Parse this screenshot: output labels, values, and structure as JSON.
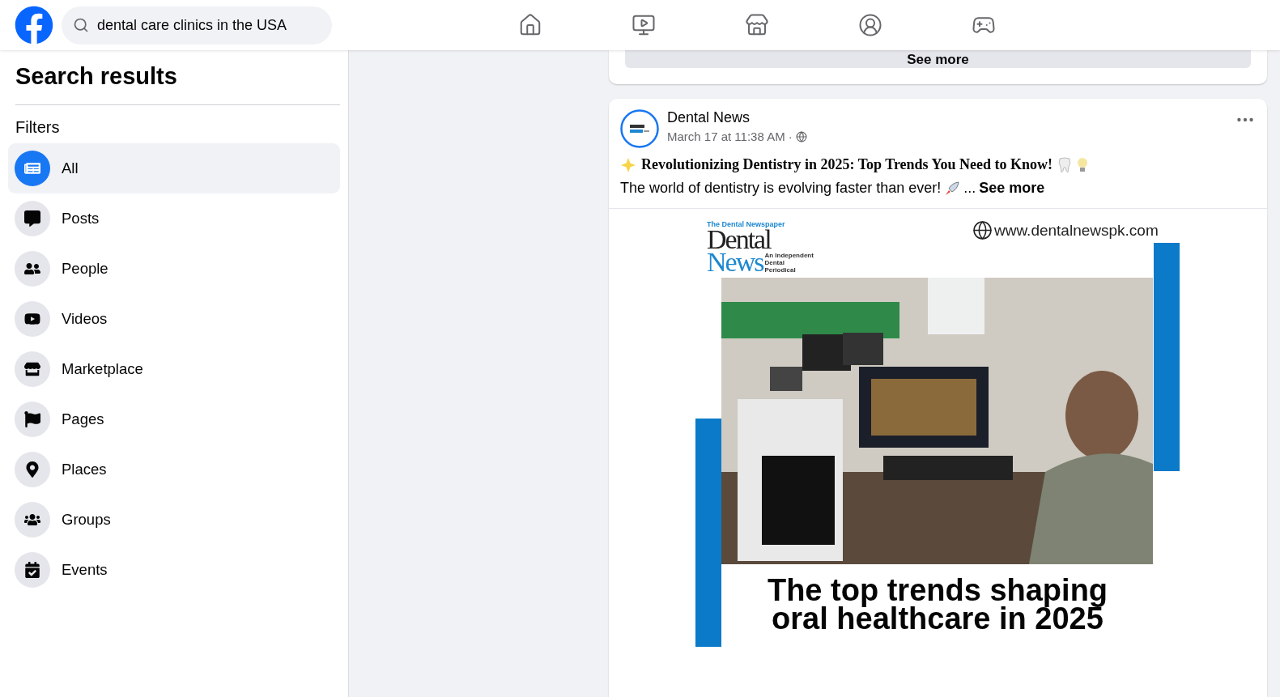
{
  "header": {
    "search": {
      "value": "dental care clinics in the USA"
    }
  },
  "sidebar": {
    "title": "Search results",
    "filters_heading": "Filters",
    "filters": [
      {
        "kind": "all",
        "label": "All",
        "selected": true
      },
      {
        "kind": "posts",
        "label": "Posts",
        "selected": false
      },
      {
        "kind": "people",
        "label": "People",
        "selected": false
      },
      {
        "kind": "videos",
        "label": "Videos",
        "selected": false
      },
      {
        "kind": "marketplace",
        "label": "Marketplace",
        "selected": false
      },
      {
        "kind": "pages",
        "label": "Pages",
        "selected": false
      },
      {
        "kind": "places",
        "label": "Places",
        "selected": false
      },
      {
        "kind": "groups",
        "label": "Groups",
        "selected": false
      },
      {
        "kind": "events",
        "label": "Events",
        "selected": false
      }
    ]
  },
  "feed": {
    "previous_post": {
      "see_more": "See more"
    },
    "post": {
      "author": "Dental News",
      "timestamp": "March 17 at 11:38 AM ·",
      "title": "Revolutionizing Dentistry in 2025: Top Trends You Need to Know!",
      "body": "The world of dentistry is evolving faster than ever!",
      "ellipsis": "...",
      "see_more": "See more",
      "graphic": {
        "tagline": "The Dental Newspaper",
        "logo_top": "Dental",
        "logo_bottom": "News",
        "logo_note": "An Independent Dental Periodical",
        "website": "www.dentalnewspk.com",
        "headline": [
          "The top trends shaping",
          "oral healthcare in 2025"
        ]
      }
    }
  }
}
